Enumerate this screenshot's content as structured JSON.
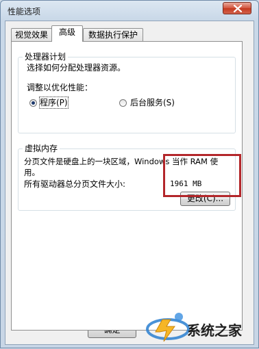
{
  "window": {
    "title": "性能选项"
  },
  "tabs": [
    {
      "label": "视觉效果",
      "active": false
    },
    {
      "label": "高级",
      "active": true
    },
    {
      "label": "数据执行保护",
      "active": false
    }
  ],
  "processor": {
    "group_title": "处理器计划",
    "description": "选择如何分配处理器资源。",
    "adjust_label": "调整以优化性能：",
    "options": [
      {
        "label": "程序(P)",
        "selected": true
      },
      {
        "label": "后台服务(S)",
        "selected": false
      }
    ]
  },
  "virtual_memory": {
    "group_title": "虚拟内存",
    "description": "分页文件是硬盘上的一块区域，Windows 当作 RAM 使用。",
    "description_line1": "分页文件是硬盘上的一块区域，Windows 当作 RAM 使",
    "description_line2": "用。",
    "total_label": "所有驱动器总分页文件大小:",
    "total_value": "1961 MB",
    "change_button": "更改(C)..."
  },
  "footer": {
    "ok_button": "确定"
  },
  "watermark": {
    "text": "系统之家"
  },
  "colors": {
    "highlight": "#b3262a",
    "close_button": "#c4391f"
  }
}
